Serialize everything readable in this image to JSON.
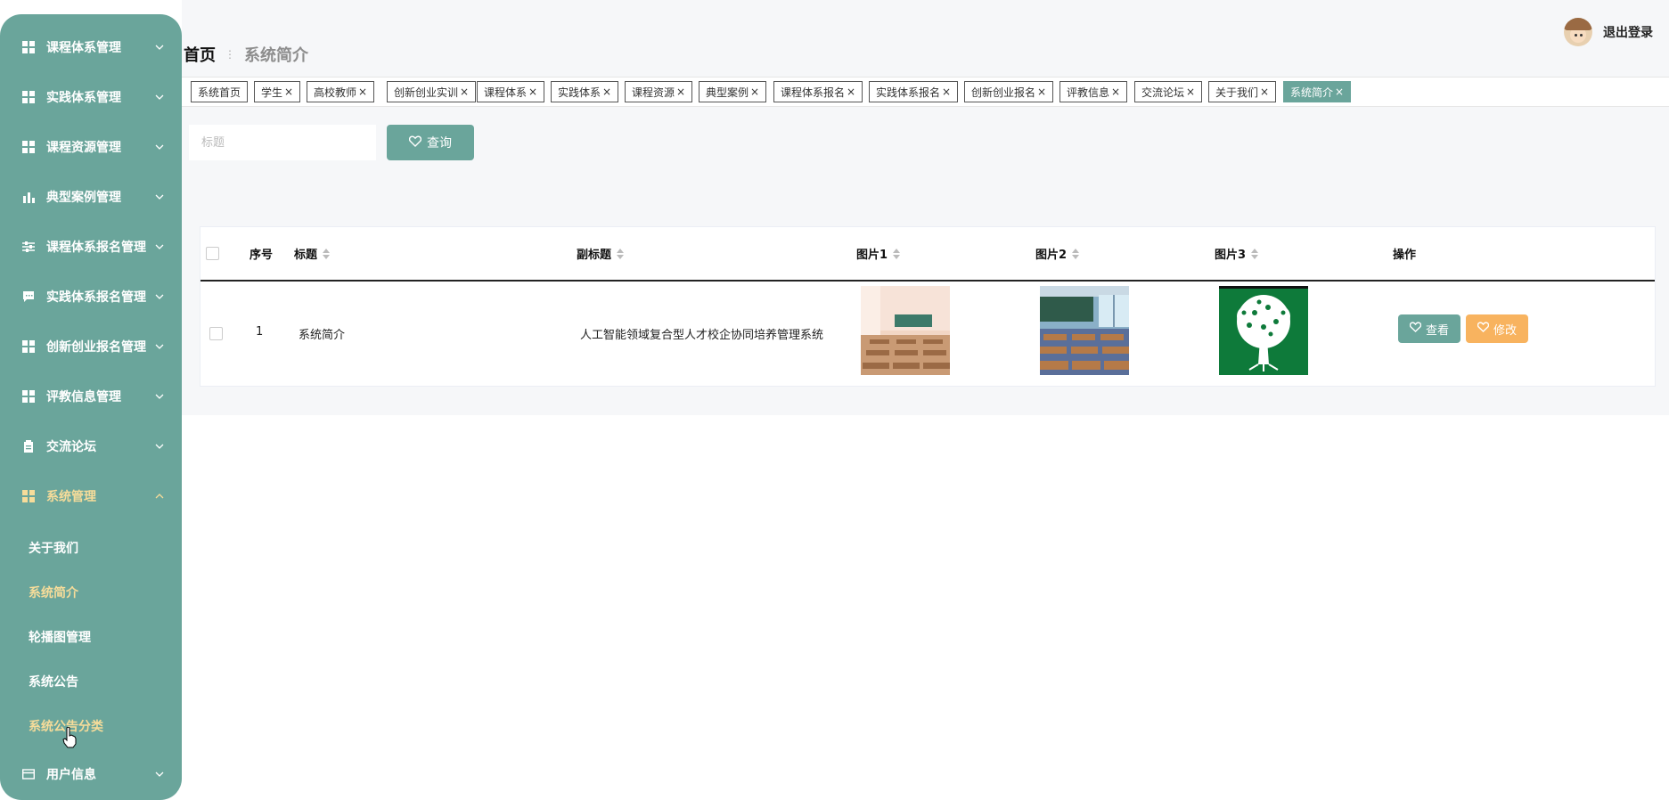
{
  "sidebar": {
    "menus": [
      {
        "label": "课程体系管理",
        "icon": "grid-icon"
      },
      {
        "label": "实践体系管理",
        "icon": "grid-icon"
      },
      {
        "label": "课程资源管理",
        "icon": "grid-icon"
      },
      {
        "label": "典型案例管理",
        "icon": "bar-chart-icon"
      },
      {
        "label": "课程体系报名管理",
        "icon": "sliders-icon"
      },
      {
        "label": "实践体系报名管理",
        "icon": "chat-icon"
      },
      {
        "label": "创新创业报名管理",
        "icon": "grid-icon"
      },
      {
        "label": "评教信息管理",
        "icon": "grid-icon"
      },
      {
        "label": "交流论坛",
        "icon": "clipboard-icon"
      },
      {
        "label": "系统管理",
        "icon": "grid-icon"
      },
      {
        "label": "用户信息",
        "icon": "card-icon"
      }
    ],
    "submenu": [
      "关于我们",
      "系统简介",
      "轮播图管理",
      "系统公告",
      "系统公告分类"
    ]
  },
  "breadcrumb": {
    "home": "首页",
    "current": "系统简介"
  },
  "user": {
    "logout": "退出登录"
  },
  "tabs": [
    "系统首页",
    "学生",
    "高校教师",
    "创新创业实训",
    "课程体系",
    "实践体系",
    "课程资源",
    "典型案例",
    "课程体系报名",
    "实践体系报名",
    "创新创业报名",
    "评教信息",
    "交流论坛",
    "关于我们",
    "系统简介"
  ],
  "search": {
    "placeholder": "标题",
    "button": "查询"
  },
  "table": {
    "headers": [
      "序号",
      "标题",
      "副标题",
      "图片1",
      "图片2",
      "图片3",
      "操作"
    ],
    "rows": [
      {
        "index": "1",
        "title": "系统简介",
        "subtitle": "人工智能领域复合型人才校企协同培养管理系统",
        "view": "查看",
        "edit": "修改"
      }
    ]
  },
  "colors": {
    "primary": "#6aa59b",
    "highlight": "#f6dc9a",
    "warning": "#f8b35f"
  }
}
